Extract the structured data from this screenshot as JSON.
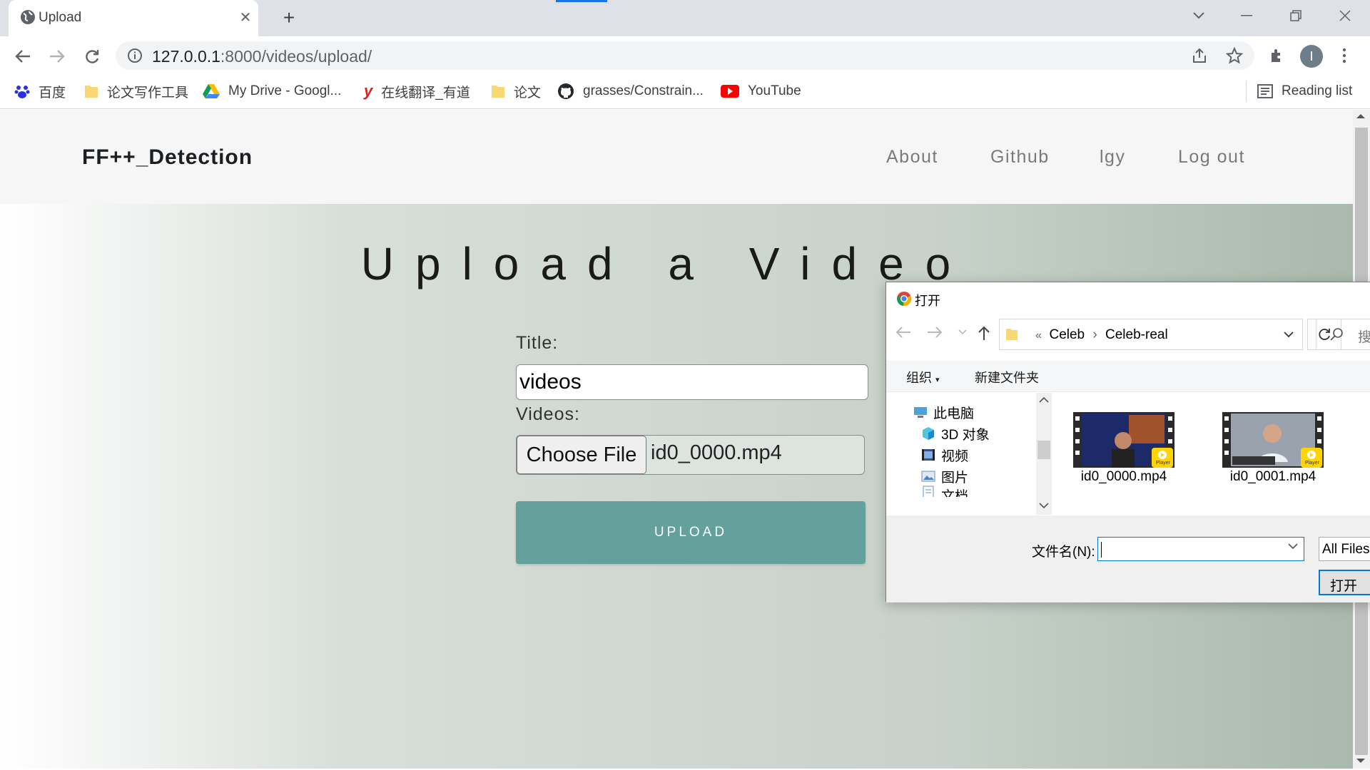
{
  "browser": {
    "tab_title": "Upload",
    "tab_close": "✕",
    "new_tab": "+",
    "url_host": "127.0.0.1",
    "url_path": ":8000/videos/upload/",
    "bookmarks": [
      {
        "label": "百度",
        "icon": "baidu-icon"
      },
      {
        "label": "论文写作工具",
        "icon": "folder-icon"
      },
      {
        "label": "My Drive - Googl...",
        "icon": "google-drive-icon"
      },
      {
        "label": "在线翻译_有道",
        "icon": "youdao-icon"
      },
      {
        "label": "论文",
        "icon": "folder-icon"
      },
      {
        "label": "grasses/Constrain...",
        "icon": "github-icon"
      },
      {
        "label": "YouTube",
        "icon": "youtube-icon"
      }
    ],
    "reading_list": "Reading list",
    "profile_initial": "I"
  },
  "site": {
    "brand": "FF++_Detection",
    "nav": [
      "About",
      "Github",
      "lgy",
      "Log out"
    ],
    "heading": "Upload a Video",
    "title_label": "Title:",
    "title_value": "videos",
    "videos_label": "Videos:",
    "choose_file": "Choose File",
    "chosen_file": "id0_0000.mp4",
    "upload_button": "UPLOAD"
  },
  "dialog": {
    "title": "打开",
    "breadcrumb_prefix": "«",
    "breadcrumb": [
      "Celeb",
      "Celeb-real"
    ],
    "search_placeholder": "搜",
    "organize": "组织",
    "new_folder": "新建文件夹",
    "tree": [
      {
        "label": "此电脑",
        "icon": "this-pc-icon"
      },
      {
        "label": "3D 对象",
        "icon": "3d-objects-icon"
      },
      {
        "label": "视频",
        "icon": "videos-folder-icon"
      },
      {
        "label": "图片",
        "icon": "pictures-folder-icon"
      },
      {
        "label": "文档",
        "icon": "documents-folder-icon"
      }
    ],
    "files": [
      {
        "name": "id0_0000.mp4",
        "badge": "Player"
      },
      {
        "name": "id0_0001.mp4",
        "badge": "Player"
      }
    ],
    "filename_label": "文件名(N):",
    "filename_value": "",
    "filetype": "All Files",
    "open_button": "打开"
  }
}
